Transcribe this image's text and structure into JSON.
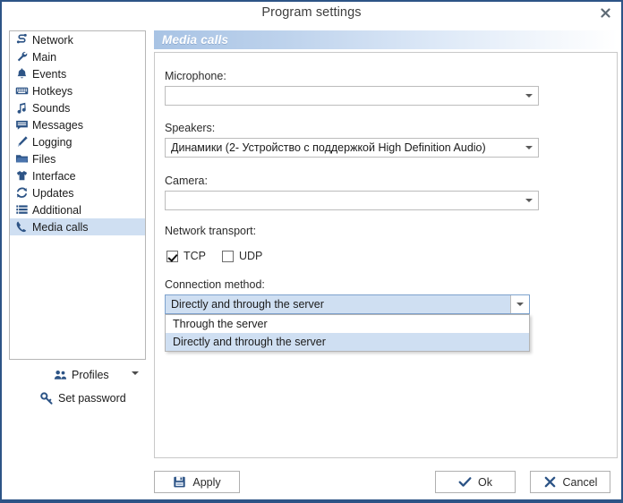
{
  "window": {
    "title": "Program settings",
    "close_label": "✖",
    "border_color": "#2d5486"
  },
  "sidebar": {
    "items": [
      {
        "label": "Network",
        "icon": "network-icon",
        "selected": false
      },
      {
        "label": "Main",
        "icon": "wrench-icon",
        "selected": false
      },
      {
        "label": "Events",
        "icon": "bell-icon",
        "selected": false
      },
      {
        "label": "Hotkeys",
        "icon": "keyboard-icon",
        "selected": false
      },
      {
        "label": "Sounds",
        "icon": "music-note-icon",
        "selected": false
      },
      {
        "label": "Messages",
        "icon": "message-icon",
        "selected": false
      },
      {
        "label": "Logging",
        "icon": "pencil-icon",
        "selected": false
      },
      {
        "label": "Files",
        "icon": "folder-icon",
        "selected": false
      },
      {
        "label": "Interface",
        "icon": "tshirt-icon",
        "selected": false
      },
      {
        "label": "Updates",
        "icon": "refresh-icon",
        "selected": false
      },
      {
        "label": "Additional",
        "icon": "list-icon",
        "selected": false
      },
      {
        "label": "Media calls",
        "icon": "phone-icon",
        "selected": true
      }
    ],
    "actions": {
      "profiles_label": "Profiles",
      "profiles_icon": "people-icon",
      "set_password_label": "Set password",
      "set_password_icon": "key-icon"
    },
    "selection_color": "#cfdff2"
  },
  "panel": {
    "header_title": "Media calls",
    "fields": {
      "microphone_label": "Microphone:",
      "microphone_value": "",
      "speakers_label": "Speakers:",
      "speakers_value": "Динамики (2- Устройство с поддержкой High Definition Audio)",
      "camera_label": "Camera:",
      "camera_value": "",
      "network_transport_label": "Network transport:",
      "tcp_label": "TCP",
      "tcp_checked": true,
      "udp_label": "UDP",
      "udp_checked": false,
      "connection_method_label": "Connection method:",
      "connection_method_value": "Directly and through the server",
      "connection_method_options": [
        {
          "label": "Through the server",
          "highlighted": false
        },
        {
          "label": "Directly and through the server",
          "highlighted": true
        }
      ]
    }
  },
  "footer": {
    "apply_label": "Apply",
    "apply_icon": "save-icon",
    "ok_label": "Ok",
    "ok_icon": "check-icon",
    "cancel_label": "Cancel",
    "cancel_icon": "cross-icon"
  }
}
